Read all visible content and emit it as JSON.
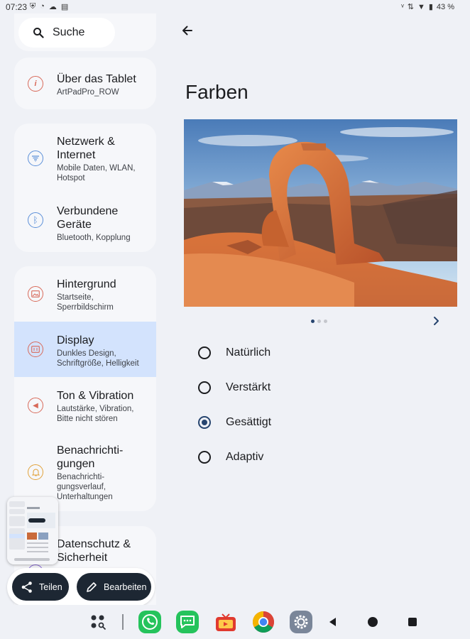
{
  "status_bar": {
    "time": "07:23",
    "battery": "43 %"
  },
  "search": {
    "label": "Suche"
  },
  "settings_items": [
    {
      "title": "Über das Tablet",
      "subtitle": "ArtPadPro_ROW"
    },
    {
      "title": "Netzwerk & Internet",
      "subtitle": "Mobile Daten, WLAN, Hotspot"
    },
    {
      "title": "Verbundene Geräte",
      "subtitle": "Bluetooth, Kopplung"
    },
    {
      "title": "Hintergrund",
      "subtitle": "Startseite, Sperrbildschirm"
    },
    {
      "title": "Display",
      "subtitle": "Dunkles Design, Schriftgröße, Helligkeit"
    },
    {
      "title": "Ton & Vibration",
      "subtitle": "Lautstärke, Vibration, Bitte nicht stören"
    },
    {
      "title": "Benachrichti-gungen",
      "subtitle": "Benachrichti-gungsverlauf, Unterhaltungen"
    },
    {
      "title": "Datenschutz & Sicherheit",
      "subtitle": ""
    }
  ],
  "page": {
    "title": "Farben"
  },
  "color_options": [
    {
      "label": "Natürlich",
      "checked": false
    },
    {
      "label": "Verstärkt",
      "checked": false
    },
    {
      "label": "Gesättigt",
      "checked": true
    },
    {
      "label": "Adaptiv",
      "checked": false
    }
  ],
  "screenshot_actions": {
    "share_label": "Teilen",
    "edit_label": "Bearbeiten"
  },
  "colors": {
    "accent": "#27456f",
    "selected_bg": "#d3e3fd",
    "background": "#eff1f6"
  }
}
